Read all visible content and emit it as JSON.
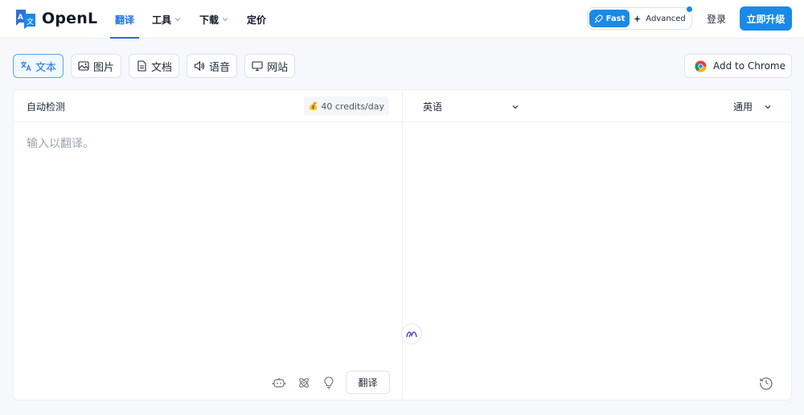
{
  "header": {
    "logo_text": "OpenL",
    "nav": [
      {
        "label": "翻译",
        "active": true,
        "has_caret": false
      },
      {
        "label": "工具",
        "active": false,
        "has_caret": true
      },
      {
        "label": "下载",
        "active": false,
        "has_caret": true
      },
      {
        "label": "定价",
        "active": false,
        "has_caret": false
      }
    ],
    "mode_fast": "Fast",
    "mode_advanced": "Advanced",
    "login": "登录",
    "upgrade": "立即升级"
  },
  "input_types": [
    {
      "label": "文本",
      "icon": "translate-icon",
      "active": true
    },
    {
      "label": "图片",
      "icon": "image-icon",
      "active": false
    },
    {
      "label": "文档",
      "icon": "document-icon",
      "active": false
    },
    {
      "label": "语音",
      "icon": "speaker-icon",
      "active": false
    },
    {
      "label": "网站",
      "icon": "monitor-icon",
      "active": false
    }
  ],
  "add_chrome": "Add to Chrome",
  "source": {
    "language": "自动检测",
    "credits": "40 credits/day",
    "placeholder": "输入以翻译。",
    "translate_button": "翻译"
  },
  "target": {
    "language": "英语",
    "domain": "通用"
  },
  "colors": {
    "accent": "#1a8ae6",
    "active_nav": "#1a73e8"
  }
}
